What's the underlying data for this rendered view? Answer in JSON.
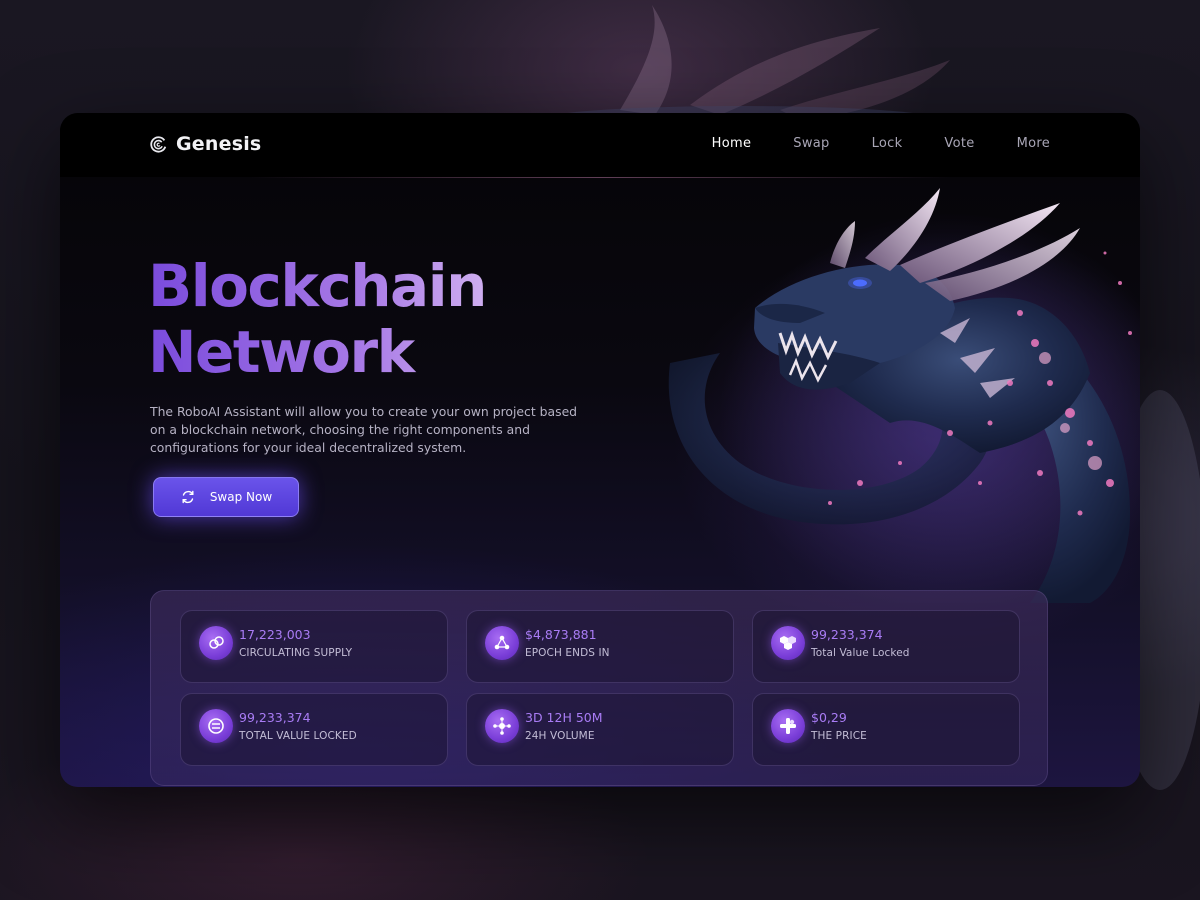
{
  "brand": {
    "name": "Genesis",
    "icon": "swirl-logo-icon"
  },
  "nav": {
    "items": [
      {
        "label": "Home",
        "active": true
      },
      {
        "label": "Swap",
        "active": false
      },
      {
        "label": "Lock",
        "active": false
      },
      {
        "label": "Vote",
        "active": false
      },
      {
        "label": "More",
        "active": false
      }
    ]
  },
  "hero": {
    "title_line1": "Blockchain",
    "title_line2": "Network",
    "description": "The RoboAI Assistant will allow you to create your own project based on a blockchain network, choosing the right components and configurations for your ideal decentralized system.",
    "cta": {
      "label": "Swap Now",
      "icon": "refresh-icon"
    },
    "image": "dragon-illustration"
  },
  "stats": [
    {
      "value": "17,223,003",
      "label": "CIRCULATING SUPPLY",
      "icon": "link-coin-icon"
    },
    {
      "value": "$4,873,881",
      "label": "EPOCH ENDS IN",
      "icon": "nodes-icon"
    },
    {
      "value": "99,233,374",
      "label": "Total Value Locked",
      "icon": "cubes-icon"
    },
    {
      "value": "99,233,374",
      "label": "TOTAL VALUE LOCKED",
      "icon": "coin-stack-icon"
    },
    {
      "value": "3D 12H 50M",
      "label": "24H VOLUME",
      "icon": "network-icon"
    },
    {
      "value": "$0,29",
      "label": "THE PRICE",
      "icon": "puzzle-icon"
    }
  ],
  "colors": {
    "accent": "#6a54ea",
    "stat_value": "#a97cf5",
    "title_gradient_start": "#7a4bdc",
    "title_gradient_end": "#efe1fb",
    "nav_bg": "#000000"
  }
}
